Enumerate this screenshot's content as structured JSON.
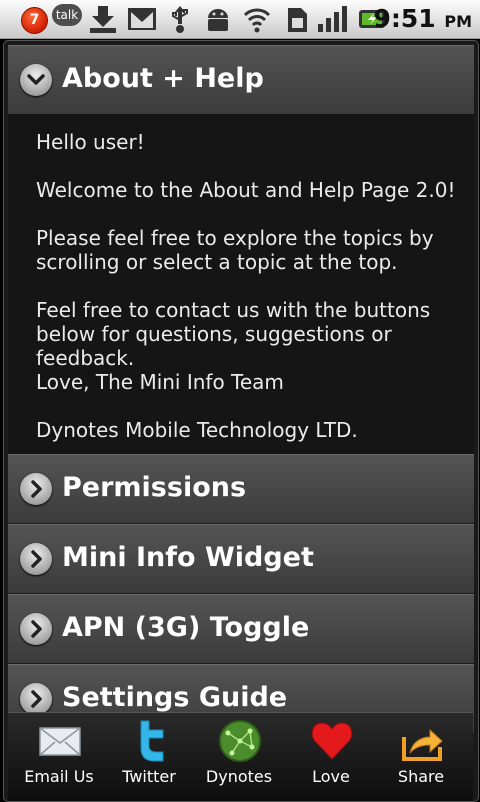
{
  "status_bar": {
    "notification_count": "7",
    "talk_label": "talk",
    "time": "9:51",
    "ampm": "PM"
  },
  "sections": [
    {
      "title": "About + Help",
      "expanded": true
    },
    {
      "title": "Permissions",
      "expanded": false
    },
    {
      "title": "Mini Info Widget",
      "expanded": false
    },
    {
      "title": "APN (3G) Toggle",
      "expanded": false
    },
    {
      "title": "Settings Guide",
      "expanded": false
    }
  ],
  "about": {
    "greeting": "Hello user!",
    "welcome": "Welcome to the About and Help Page 2.0!",
    "explore": "Please feel free to explore the topics by scrolling or select a topic at the top.",
    "contact": "Feel free to contact us with the buttons below for questions, suggestions or feedback.",
    "signoff": "Love, The Mini Info Team",
    "company": "Dynotes Mobile Technology LTD."
  },
  "toolbar": [
    {
      "label": "Email Us",
      "icon": "envelope-icon"
    },
    {
      "label": "Twitter",
      "icon": "twitter-bird-icon"
    },
    {
      "label": "Dynotes",
      "icon": "dynotes-globe-icon"
    },
    {
      "label": "Love",
      "icon": "heart-icon"
    },
    {
      "label": "Share",
      "icon": "share-arrow-icon"
    }
  ]
}
